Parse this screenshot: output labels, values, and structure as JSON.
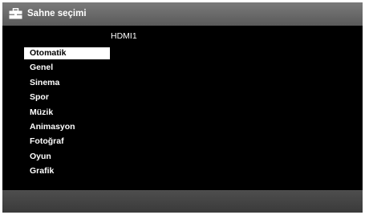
{
  "header": {
    "icon": "toolbox-icon",
    "title": "Sahne seçimi"
  },
  "source": {
    "label": "HDMI1"
  },
  "menu": {
    "selected_index": 0,
    "items": [
      {
        "label": "Otomatik"
      },
      {
        "label": "Genel"
      },
      {
        "label": "Sinema"
      },
      {
        "label": "Spor"
      },
      {
        "label": "Müzik"
      },
      {
        "label": "Animasyon"
      },
      {
        "label": "Fotoğraf"
      },
      {
        "label": "Oyun"
      },
      {
        "label": "Grafik"
      }
    ]
  },
  "colors": {
    "background": "#000000",
    "header_bar": "#6a6a6a",
    "footer_bar": "#444444",
    "selection": "#ffffff",
    "text": "#ffffff"
  }
}
